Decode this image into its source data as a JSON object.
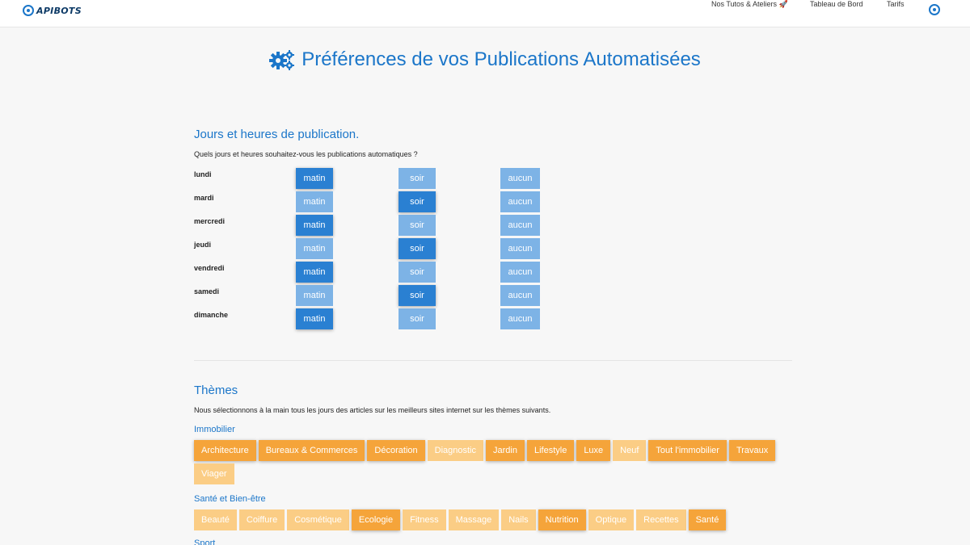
{
  "brand": {
    "name": "APIBOTS"
  },
  "nav": {
    "links": [
      "Nos Tutos & Ateliers 🚀",
      "Tableau de Bord",
      "Tarifs"
    ],
    "link_positions_note": ""
  },
  "page": {
    "title": "Préférences de vos Publications Automatisées"
  },
  "schedule": {
    "title": "Jours et heures de publication.",
    "question": "Quels jours et heures souhaitez-vous les publications automatiques ?",
    "option_labels": [
      "matin",
      "soir",
      "aucun"
    ],
    "days": [
      {
        "name": "lundi",
        "selected": "matin"
      },
      {
        "name": "mardi",
        "selected": "soir"
      },
      {
        "name": "mercredi",
        "selected": "matin"
      },
      {
        "name": "jeudi",
        "selected": "soir"
      },
      {
        "name": "vendredi",
        "selected": "matin"
      },
      {
        "name": "samedi",
        "selected": "soir"
      },
      {
        "name": "dimanche",
        "selected": "matin"
      }
    ]
  },
  "themes": {
    "title": "Thèmes",
    "description": "Nous sélectionnons à la main tous les jours des articles sur les meilleurs sites internet sur les thèmes suivants.",
    "categories": [
      {
        "name": "Immobilier",
        "tags": [
          {
            "label": "Architecture",
            "selected": true
          },
          {
            "label": "Bureaux & Commerces",
            "selected": true
          },
          {
            "label": "Décoration",
            "selected": true
          },
          {
            "label": "Diagnostic",
            "selected": false
          },
          {
            "label": "Jardin",
            "selected": true
          },
          {
            "label": "Lifestyle",
            "selected": true
          },
          {
            "label": "Luxe",
            "selected": true
          },
          {
            "label": "Neuf",
            "selected": false
          },
          {
            "label": "Tout l'immobilier",
            "selected": true
          },
          {
            "label": "Travaux",
            "selected": true
          },
          {
            "label": "Viager",
            "selected": false
          }
        ]
      },
      {
        "name": "Santé et Bien-être",
        "tags": [
          {
            "label": "Beauté",
            "selected": false
          },
          {
            "label": "Coiffure",
            "selected": false
          },
          {
            "label": "Cosmétique",
            "selected": false
          },
          {
            "label": "Ecologie",
            "selected": true
          },
          {
            "label": "Fitness",
            "selected": false
          },
          {
            "label": "Massage",
            "selected": false
          },
          {
            "label": "Nails",
            "selected": false
          },
          {
            "label": "Nutrition",
            "selected": true
          },
          {
            "label": "Optique",
            "selected": false
          },
          {
            "label": "Recettes",
            "selected": false
          },
          {
            "label": "Santé",
            "selected": true
          }
        ]
      },
      {
        "name": "Sport",
        "tags": []
      }
    ]
  },
  "colors": {
    "accent_blue": "#1b76c9",
    "button_on": "#2a80d2",
    "button_off": "#7db3e6",
    "tag_on": "#f5a43a",
    "tag_off": "#fbcd85"
  }
}
